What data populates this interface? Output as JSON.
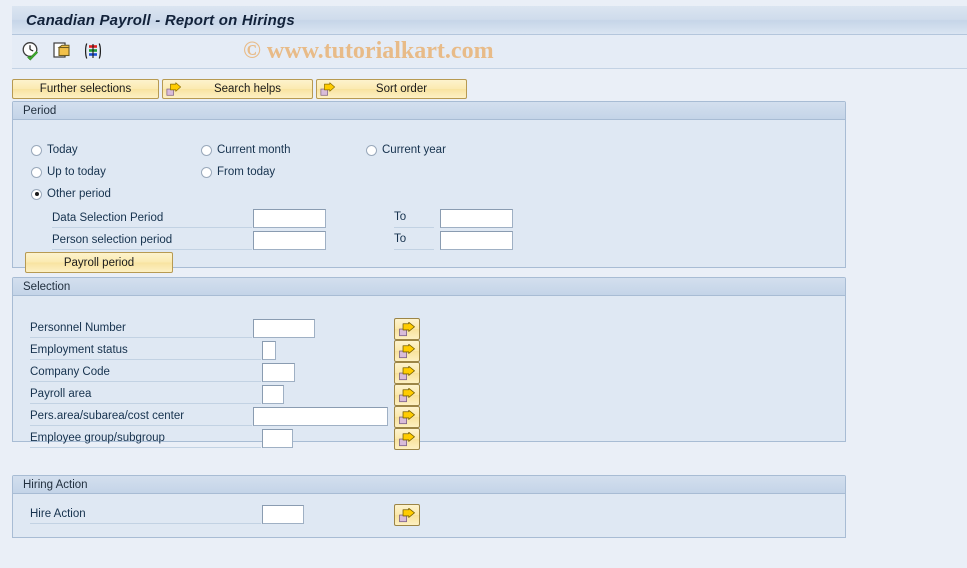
{
  "window": {
    "title": "Canadian Payroll - Report on Hirings"
  },
  "watermark": {
    "text": "© www.tutorialkart.com"
  },
  "toolbar": {
    "icons": [
      {
        "name": "execute-clock-icon",
        "title": "Execute"
      },
      {
        "name": "copy-document-icon",
        "title": "Get Variant"
      },
      {
        "name": "colored-bars-icon",
        "title": "Display Variants"
      }
    ]
  },
  "buttons": {
    "further_selections": "Further selections",
    "search_helps": "Search helps",
    "sort_order": "Sort order"
  },
  "period": {
    "title": "Period",
    "options": [
      {
        "label": "Today",
        "selected": false
      },
      {
        "label": "Current month",
        "selected": false
      },
      {
        "label": "Current year",
        "selected": false
      },
      {
        "label": "Up to today",
        "selected": false
      },
      {
        "label": "From today",
        "selected": false
      },
      {
        "label": "Other period",
        "selected": true
      }
    ],
    "rows": [
      {
        "label": "Data Selection Period",
        "value": "",
        "to_label": "To",
        "to_value": ""
      },
      {
        "label": "Person selection period",
        "value": "",
        "to_label": "To",
        "to_value": ""
      }
    ],
    "payroll_period_button": "Payroll period"
  },
  "selection": {
    "title": "Selection",
    "rows": [
      {
        "label": "Personnel Number",
        "value": ""
      },
      {
        "label": "Employment status",
        "value": ""
      },
      {
        "label": "Company Code",
        "value": ""
      },
      {
        "label": "Payroll area",
        "value": ""
      },
      {
        "label": "Pers.area/subarea/cost center",
        "value": ""
      },
      {
        "label": "Employee group/subgroup",
        "value": ""
      }
    ]
  },
  "hiring_action": {
    "title": "Hiring Action",
    "rows": [
      {
        "label": "Hire Action",
        "value": ""
      }
    ]
  },
  "colors": {
    "background": "#eaeff7",
    "panel": "#dfe8f3",
    "panel_border": "#a8bcd4",
    "button_yellow": "#fbeab0",
    "watermark": "#e8bb88",
    "arrow_yellow": "#ffcc00",
    "arrow_folder": "#d9bcd9"
  }
}
